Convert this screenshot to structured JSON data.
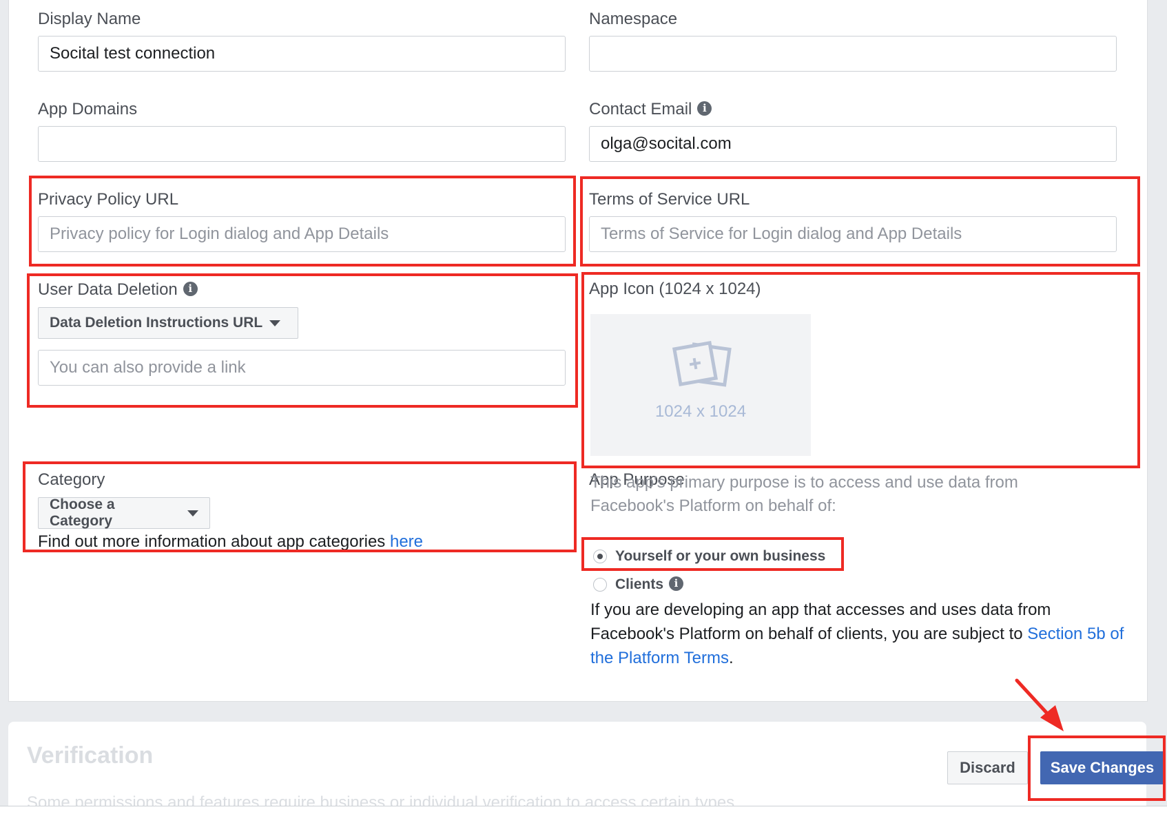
{
  "form": {
    "display_name": {
      "label": "Display Name",
      "value": "Socital test connection"
    },
    "namespace": {
      "label": "Namespace",
      "value": ""
    },
    "app_domains": {
      "label": "App Domains",
      "value": ""
    },
    "contact_email": {
      "label": "Contact Email",
      "value": "olga@socital.com"
    },
    "privacy_policy": {
      "label": "Privacy Policy URL",
      "placeholder": "Privacy policy for Login dialog and App Details"
    },
    "terms_of_service": {
      "label": "Terms of Service URL",
      "placeholder": "Terms of Service for Login dialog and App Details"
    },
    "user_data_deletion": {
      "label": "User Data Deletion",
      "dropdown": "Data Deletion Instructions URL",
      "placeholder": "You can also provide a link"
    },
    "app_icon": {
      "label": "App Icon (1024 x 1024)",
      "placeholder_text": "1024 x 1024"
    },
    "category": {
      "label": "Category",
      "dropdown": "Choose a Category",
      "help_text": "Find out more information about app categories ",
      "help_link": "here"
    },
    "app_purpose": {
      "label": "App Purpose",
      "description": "This app's primary purpose is to access and use data from Facebook's Platform on behalf of:",
      "options": [
        {
          "label": "Yourself or your own business",
          "selected": true
        },
        {
          "label": "Clients",
          "selected": false
        }
      ],
      "clients_note": "If you are developing an app that accesses and uses data from Facebook's Platform on behalf of clients, you are subject to ",
      "clients_link": "Section 5b of the Platform Terms",
      "clients_note_end": "."
    }
  },
  "verification": {
    "title": "Verification",
    "subtitle": "Some permissions and features require business or individual verification to access certain types"
  },
  "actions": {
    "discard": "Discard",
    "save": "Save Changes"
  },
  "annotation_color": "#ee2a24",
  "icons": {
    "info": "info-icon",
    "dropdown": "caret-down-icon",
    "image_upload": "image-upload-icon",
    "arrow": "red-arrow"
  }
}
